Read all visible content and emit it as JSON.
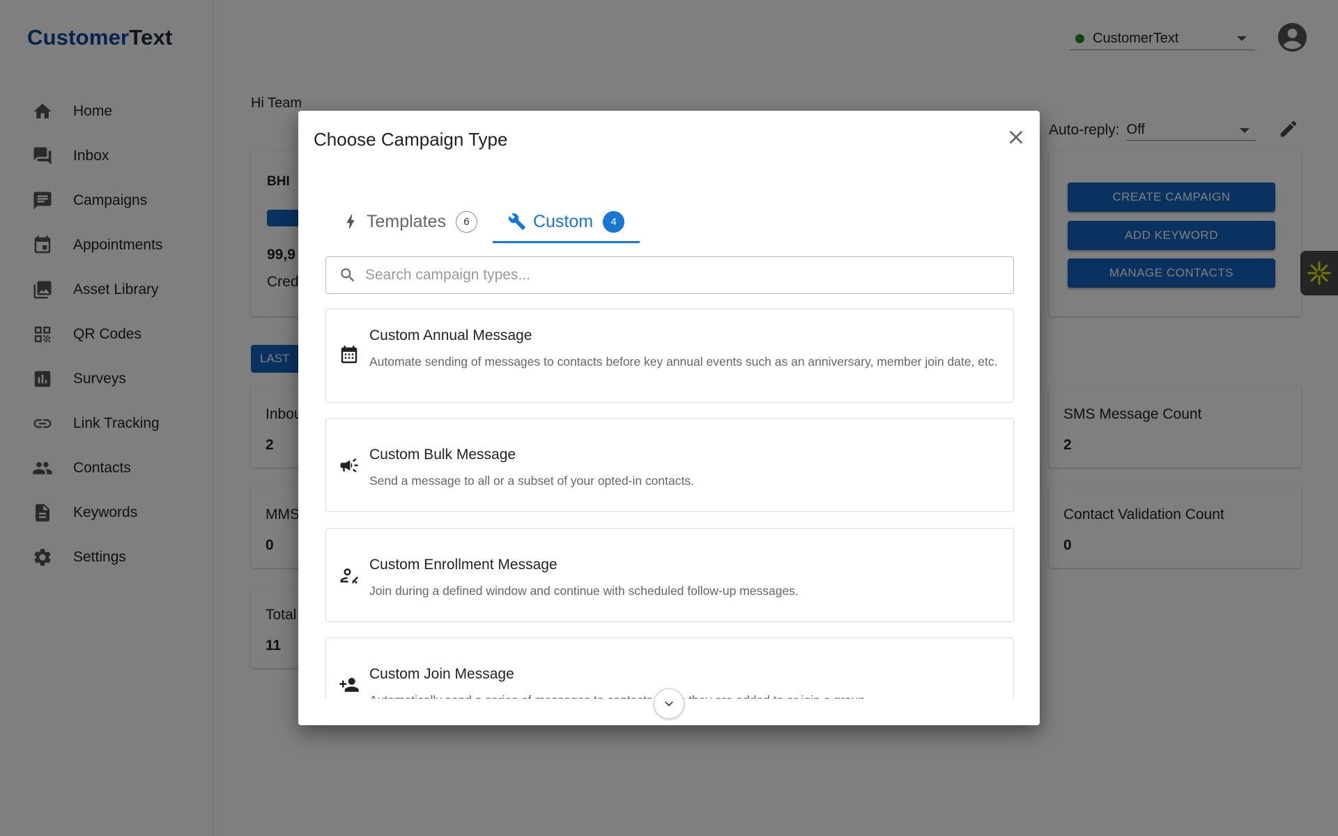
{
  "app": {
    "logo_part1": "Customer",
    "logo_part2": "Text",
    "account_name": "CustomerText"
  },
  "sidebar": {
    "items": [
      {
        "label": "Home",
        "icon": "home-icon"
      },
      {
        "label": "Inbox",
        "icon": "inbox-icon"
      },
      {
        "label": "Campaigns",
        "icon": "campaigns-icon"
      },
      {
        "label": "Appointments",
        "icon": "calendar-icon"
      },
      {
        "label": "Asset Library",
        "icon": "photo-library-icon"
      },
      {
        "label": "QR Codes",
        "icon": "qr-code-icon"
      },
      {
        "label": "Surveys",
        "icon": "bar-chart-icon"
      },
      {
        "label": "Link Tracking",
        "icon": "link-icon"
      },
      {
        "label": "Contacts",
        "icon": "people-icon"
      },
      {
        "label": "Keywords",
        "icon": "document-icon"
      },
      {
        "label": "Settings",
        "icon": "gear-icon"
      }
    ]
  },
  "main": {
    "greeting": "Hi Team",
    "autoreply_label": "Auto-reply:",
    "autoreply_value": "Off",
    "balance_name": "BHI",
    "balance_value": "99,9",
    "balance_caption": "Cred",
    "actions": {
      "create_campaign": "CREATE CAMPAIGN",
      "add_keyword": "ADD KEYWORD",
      "manage_contacts": "MANAGE CONTACTS"
    },
    "range_chip": "LAST",
    "stats_left": [
      {
        "title": "Inbou",
        "value": "2"
      },
      {
        "title": "MMS",
        "value": "0"
      },
      {
        "title": "Total",
        "value": "11"
      }
    ],
    "stats_right": [
      {
        "title": "SMS Message Count",
        "value": "2"
      },
      {
        "title": "Contact Validation Count",
        "value": "0"
      }
    ]
  },
  "modal": {
    "title": "Choose Campaign Type",
    "tabs": [
      {
        "label": "Templates",
        "count": "6",
        "icon": "bolt-icon",
        "active": false
      },
      {
        "label": "Custom",
        "count": "4",
        "icon": "wrench-icon",
        "active": true
      }
    ],
    "search_placeholder": "Search campaign types...",
    "items": [
      {
        "title": "Custom Annual Message",
        "description": "Automate sending of messages to contacts before key annual events such as an anniversary, member join date, etc.",
        "icon": "calendar-icon"
      },
      {
        "title": "Custom Bulk Message",
        "description": "Send a message to all or a subset of your opted-in contacts.",
        "icon": "megaphone-icon"
      },
      {
        "title": "Custom Enrollment Message",
        "description": "Join during a defined window and continue with scheduled follow-up messages.",
        "icon": "person-edit-icon"
      },
      {
        "title": "Custom Join Message",
        "description": "Automatically send a series of messages to contacts when they are added to or join a group.",
        "icon": "person-add-icon"
      }
    ]
  },
  "colors": {
    "primary": "#1565c0",
    "accent": "#1976d2",
    "status_online": "#1b8a1b"
  }
}
